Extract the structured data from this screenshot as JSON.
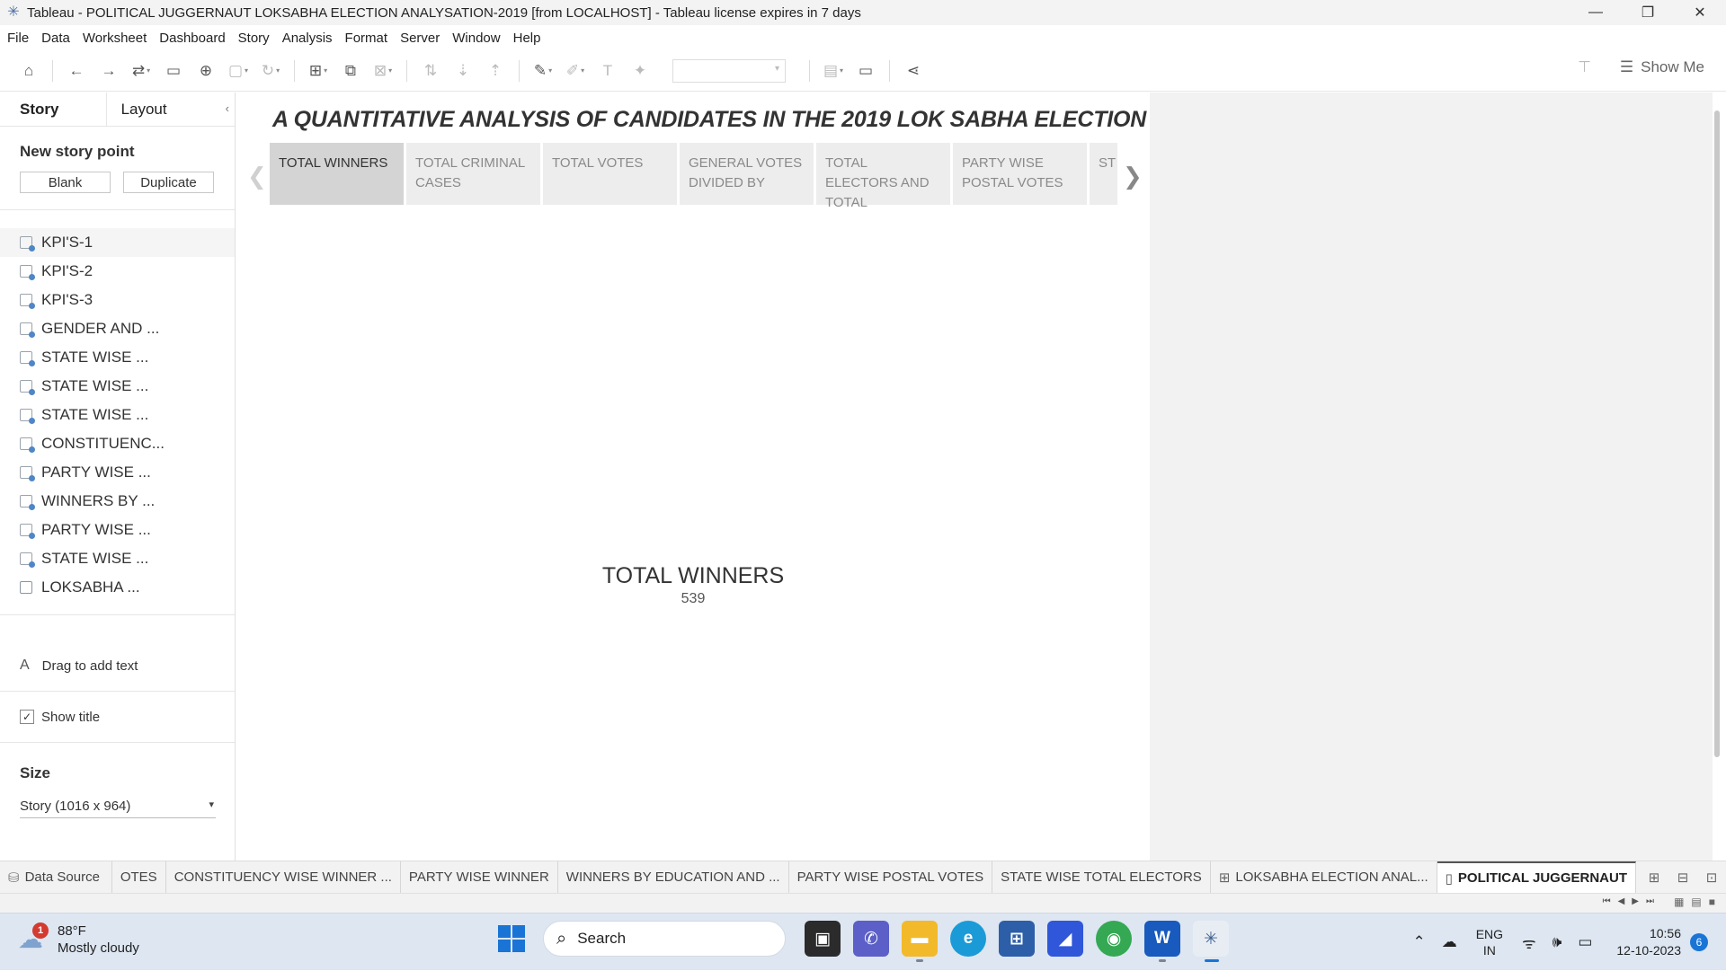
{
  "window": {
    "title": "Tableau - POLITICAL JUGGERNAUT LOKSABHA ELECTION ANALYSATION-2019 [from LOCALHOST] - Tableau license expires in 7 days",
    "controls": [
      "minimize",
      "restore",
      "close"
    ]
  },
  "menu": [
    "File",
    "Data",
    "Worksheet",
    "Dashboard",
    "Story",
    "Analysis",
    "Format",
    "Server",
    "Window",
    "Help"
  ],
  "toolbar": {
    "show_me": "Show Me"
  },
  "left_panel": {
    "tab_story": "Story",
    "tab_layout": "Layout",
    "new_story_point": "New story point",
    "blank_button": "Blank",
    "duplicate_button": "Duplicate",
    "sheets": [
      "KPI'S-1",
      "KPI'S-2",
      "KPI'S-3",
      "GENDER AND ...",
      "STATE WISE ...",
      "STATE WISE ...",
      "STATE WISE ...",
      "CONSTITUENC...",
      "PARTY WISE ...",
      "WINNERS BY ...",
      "PARTY WISE ...",
      "STATE WISE ...",
      "LOKSABHA ..."
    ],
    "drag_text": "Drag to add text",
    "drag_glyph": "A",
    "show_title": "Show title",
    "size_title": "Size",
    "size_value": "Story (1016 x 964)"
  },
  "story": {
    "title": "A QUANTITATIVE ANALYSIS OF CANDIDATES IN THE 2019 LOK SABHA ELECTION",
    "points": [
      "TOTAL WINNERS",
      "TOTAL CRIMINAL CASES",
      "TOTAL VOTES",
      "GENERAL VOTES DIVIDED BY",
      "TOTAL ELECTORS AND TOTAL",
      "PARTY WISE POSTAL VOTES",
      "ST W"
    ],
    "active_point": 0,
    "kpi_title": "TOTAL WINNERS",
    "kpi_value": "539"
  },
  "sheet_tabs": {
    "data_source": "Data Source",
    "tabs": [
      "OTES",
      "CONSTITUENCY WISE WINNER ...",
      "PARTY WISE WINNER",
      "WINNERS BY EDUCATION AND ...",
      "PARTY WISE POSTAL VOTES",
      "STATE WISE TOTAL ELECTORS",
      "LOKSABHA ELECTION ANAL...",
      "POLITICAL JUGGERNAUT"
    ]
  },
  "taskbar": {
    "weather_temp": "88°F",
    "weather_desc": "Mostly cloudy",
    "weather_badge": "1",
    "search_placeholder": "Search",
    "lang_top": "ENG",
    "lang_bottom": "IN",
    "time": "10:56",
    "date": "12-10-2023",
    "notifications": "6"
  }
}
